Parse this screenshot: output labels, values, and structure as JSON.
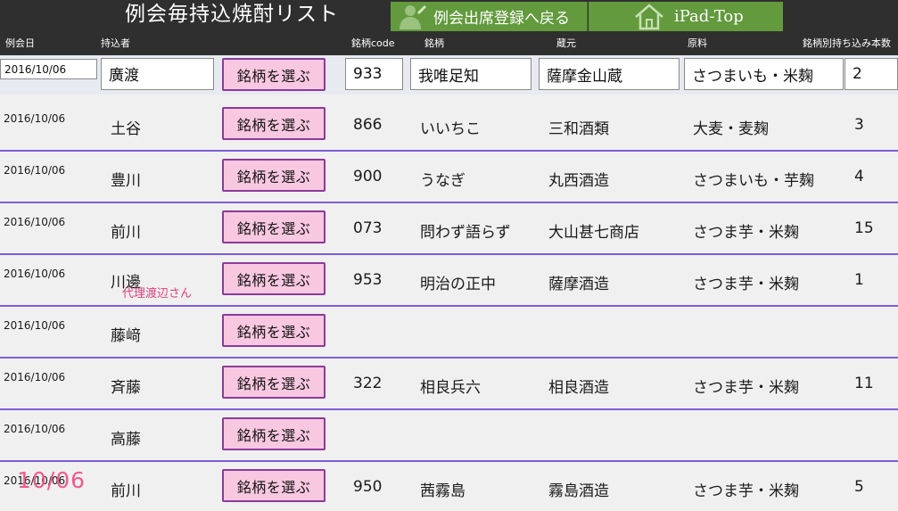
{
  "header": {
    "title": "例会毎持込焼酎リスト",
    "back_button": "例会出席登録へ戻る",
    "top_button": "iPad-Top",
    "accent": "#629a3d"
  },
  "columns": {
    "date": "例会日",
    "owner": "持込者",
    "code": "銘柄code",
    "brand": "銘柄",
    "kura": "蔵元",
    "material": "原料",
    "count": "銘柄別持ち込み本数"
  },
  "input_row": {
    "date": "2016/10/06",
    "owner": "廣渡",
    "pick": "銘柄を選ぶ",
    "code": "933",
    "brand": "我唯足知",
    "kura": "薩摩金山蔵",
    "material": "さつまいも・米麹",
    "count": "2"
  },
  "rows": [
    {
      "date": "2016/10/06",
      "owner": "土谷",
      "pick": "銘柄を選ぶ",
      "code": "866",
      "brand": "いいちこ",
      "kura": "三和酒類",
      "material": "大麦・麦麹",
      "count": "3",
      "note": ""
    },
    {
      "date": "2016/10/06",
      "owner": "豊川",
      "pick": "銘柄を選ぶ",
      "code": "900",
      "brand": "うなぎ",
      "kura": "丸西酒造",
      "material": "さつまいも・芋麹",
      "count": "4",
      "note": ""
    },
    {
      "date": "2016/10/06",
      "owner": "前川",
      "pick": "銘柄を選ぶ",
      "code": "073",
      "brand": "問わず語らず",
      "kura": "大山甚七商店",
      "material": "さつま芋・米麹",
      "count": "15",
      "note": ""
    },
    {
      "date": "2016/10/06",
      "owner": "川邊",
      "pick": "銘柄を選ぶ",
      "code": "953",
      "brand": "明治の正中",
      "kura": "薩摩酒造",
      "material": "さつま芋・米麹",
      "count": "1",
      "note": "代理渡辺さん"
    },
    {
      "date": "2016/10/06",
      "owner": "藤﨑",
      "pick": "銘柄を選ぶ",
      "code": "",
      "brand": "",
      "kura": "",
      "material": "",
      "count": "",
      "note": ""
    },
    {
      "date": "2016/10/06",
      "owner": "斉藤",
      "pick": "銘柄を選ぶ",
      "code": "322",
      "brand": "相良兵六",
      "kura": "相良酒造",
      "material": "さつま芋・米麹",
      "count": "11",
      "note": ""
    },
    {
      "date": "2016/10/06",
      "owner": "高藤",
      "pick": "銘柄を選ぶ",
      "code": "",
      "brand": "",
      "kura": "",
      "material": "",
      "count": "",
      "note": ""
    },
    {
      "date": "2016/10/06",
      "owner": "前川",
      "pick": "銘柄を選ぶ",
      "code": "950",
      "brand": "茜霧島",
      "kura": "霧島酒造",
      "material": "さつま芋・米麹",
      "count": "5",
      "note": ""
    }
  ],
  "overlay_date": "10/06"
}
